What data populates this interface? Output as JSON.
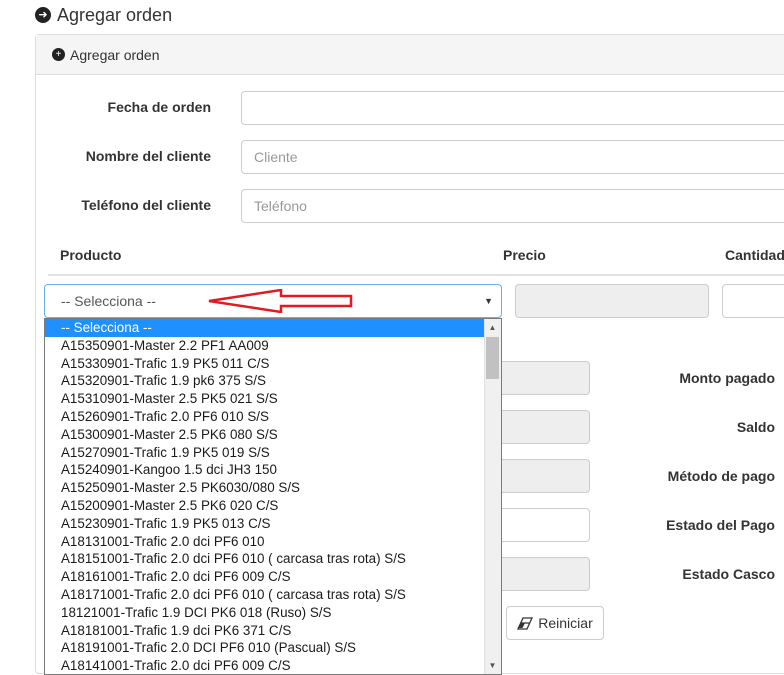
{
  "page": {
    "title": "Agregar orden"
  },
  "panel": {
    "title": "Agregar orden"
  },
  "form": {
    "fecha_label": "Fecha de orden",
    "fecha_value": "",
    "cliente_label": "Nombre del cliente",
    "cliente_placeholder": "Cliente",
    "telefono_label": "Teléfono del cliente",
    "telefono_placeholder": "Teléfono"
  },
  "table": {
    "headers": {
      "producto": "Producto",
      "precio": "Precio",
      "cantidad": "Cantidad"
    }
  },
  "select": {
    "value": "-- Selecciona --",
    "options": [
      "-- Selecciona --",
      "A15350901-Master 2.2 PF1 AA009",
      "A15330901-Trafic 1.9 PK5 011 C/S",
      "A15320901-Trafic 1.9 pk6 375 S/S",
      "A15310901-Master 2.5 PK5 021 S/S",
      "A15260901-Trafic 2.0 PF6 010 S/S",
      "A15300901-Master 2.5 PK6 080 S/S",
      "A15270901-Trafic 1.9 PK5 019 S/S",
      "A15240901-Kangoo 1.5 dci JH3 150",
      "A15250901-Master 2.5 PK6030/080 S/S",
      "A15200901-Master 2.5 PK6 020 C/S",
      "A15230901-Trafic 1.9 PK5 013 C/S",
      "A18131001-Trafic 2.0 dci PF6 010",
      "A18151001-Trafic 2.0 dci PF6 010 ( carcasa tras rota) S/S",
      "A18161001-Trafic 2.0 dci PF6 009 C/S",
      "A18171001-Trafic 2.0 dci PF6 010 ( carcasa tras rota) S/S",
      "18121001-Trafic 1.9 DCI PK6 018 (Ruso) S/S",
      "A18181001-Trafic 1.9 dci PK6 371 C/S",
      "A18191001-Trafic 2.0 DCI PF6 010 (Pascual) S/S",
      "A18141001-Trafic 2.0 dci PF6 009 C/S"
    ]
  },
  "summary": {
    "monto_pagado": "Monto pagado",
    "saldo": "Saldo",
    "metodo_pago": "Método de pago",
    "estado_pago": "Estado del Pago",
    "estado_casco": "Estado Casco"
  },
  "buttons": {
    "reset": "Reiniciar"
  },
  "icons": {
    "heading": "arrow-circle-right-icon",
    "panel": "plus-circle-icon",
    "reset": "eraser-icon",
    "select": "caret-down-icon"
  },
  "colors": {
    "highlight": "#1e90ff",
    "arrow": "#e11b22",
    "focus": "#66afe9"
  }
}
